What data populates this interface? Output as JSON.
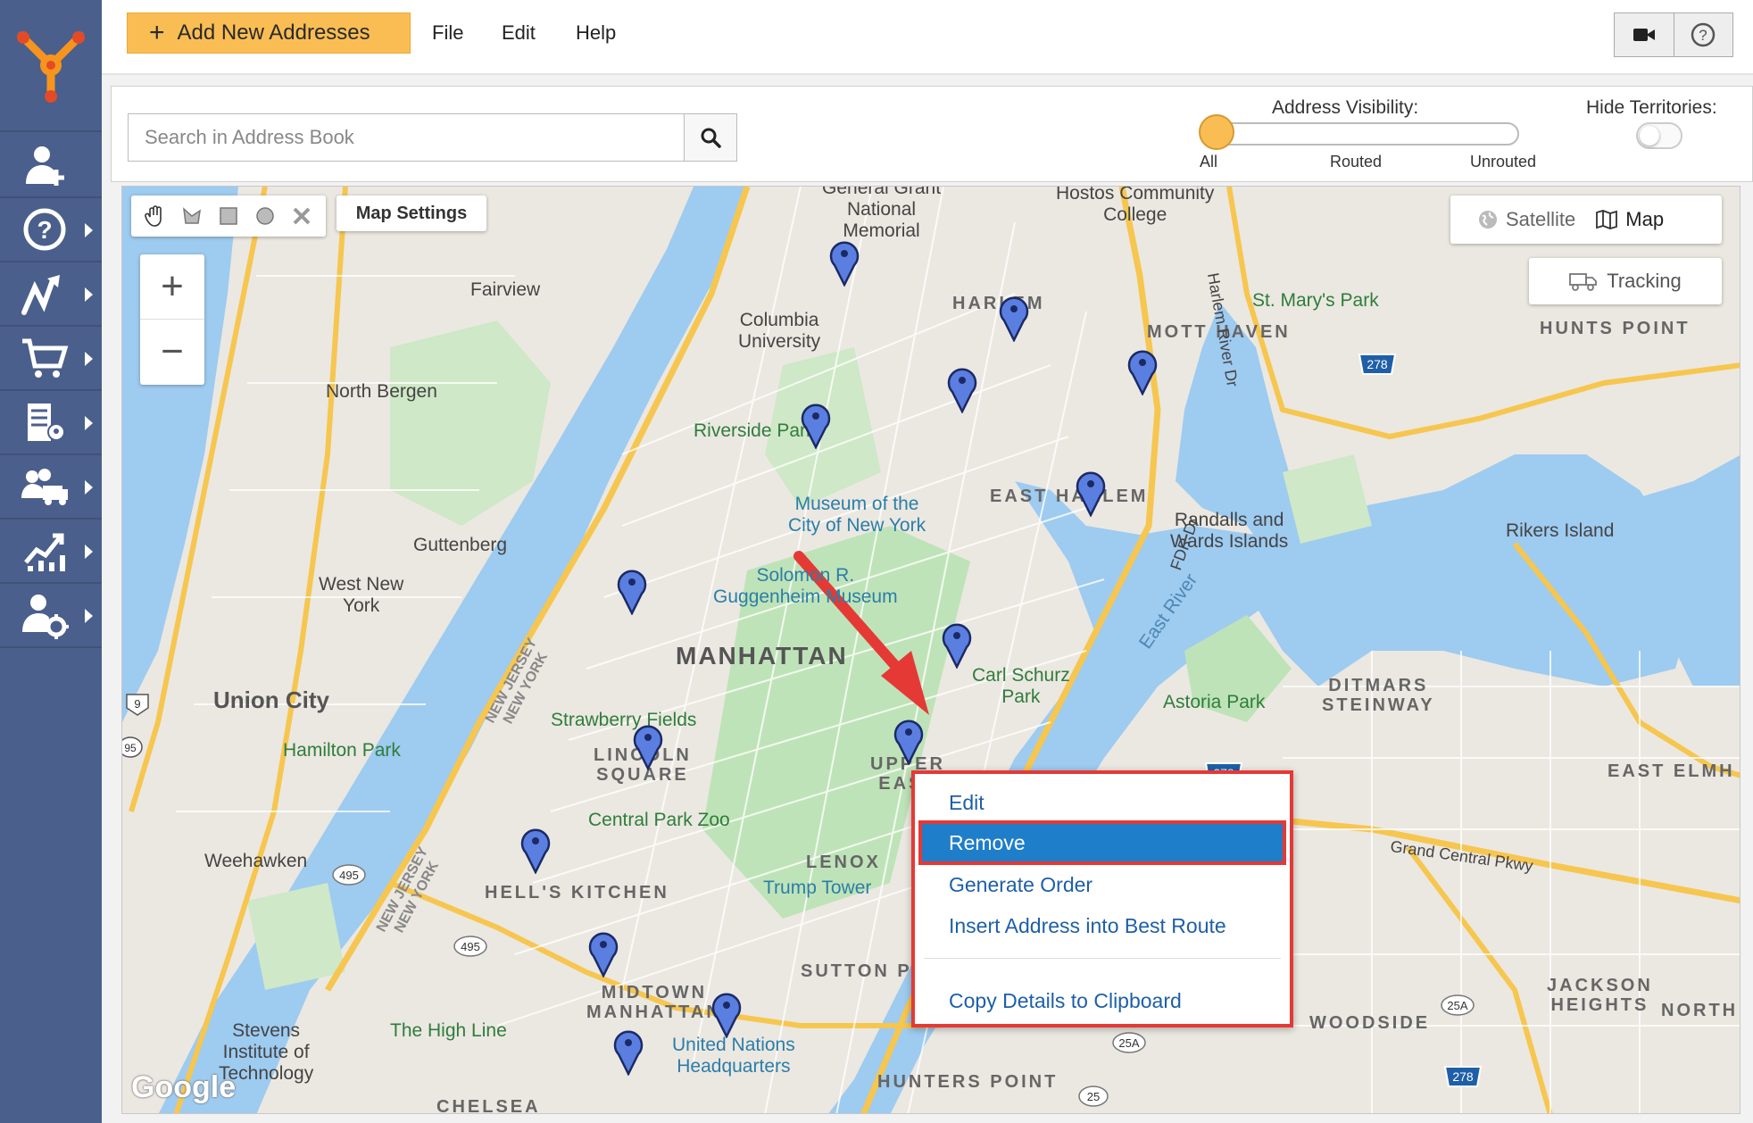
{
  "toolbar": {
    "add_label": "Add New Addresses",
    "menu": [
      "File",
      "Edit",
      "Help"
    ]
  },
  "search": {
    "placeholder": "Search in Address Book"
  },
  "visibility": {
    "title": "Address Visibility:",
    "options": [
      "All",
      "Routed",
      "Unrouted"
    ],
    "selected": "All"
  },
  "territories": {
    "title": "Hide Territories:",
    "on": false
  },
  "map": {
    "settings_label": "Map Settings",
    "type_options": [
      "Satellite",
      "Map"
    ],
    "type_selected": "Map",
    "tracking_label": "Tracking",
    "labels": {
      "manhattan": "MANHATTAN",
      "harlem": "HARLEM",
      "east_harlem": "EAST HARLEM",
      "mott_haven": "MOTT HAVEN",
      "hunts_point": "HUNTS POINT",
      "union_city": "Union City",
      "fairview": "Fairview",
      "north_bergen": "North Bergen",
      "guttenberg": "Guttenberg",
      "west_new_york": "West New\nYork",
      "weehawken": "Weehawken",
      "hamilton_park": "Hamilton Park",
      "hells_kitchen": "HELL'S KITCHEN",
      "midtown": "MIDTOWN\nMANHATTAN",
      "lincoln_square": "LINCOLN\nSQUARE",
      "upper_east": "UPPER\nEAST",
      "lenox": "LENOX",
      "sutton_place": "SUTTON PLA",
      "hunters_point": "HUNTERS POINT",
      "woodside": "WOODSIDE",
      "ditmars": "DITMARS\nSTEINWAY",
      "east_elmhurst": "EAST ELMH",
      "jackson_heights": "JACKSON\nHEIGHTS",
      "north": "NORTH",
      "chelsea": "CHELSEA",
      "columbia": "Columbia\nUniversity",
      "grant": "General Grant\nNational\nMemorial",
      "hostos": "Hostos Community\nCollege",
      "st_marys": "St. Mary's Park",
      "riverside": "Riverside Park",
      "museum_nyc": "Museum of the\nCity of New York",
      "guggenheim": "Solomon R.\nGuggenheim Museum",
      "carl_schurz": "Carl Schurz\nPark",
      "randalls": "Randalls and\nWards Islands",
      "rikers": "Rikers Island",
      "astoria_park": "Astoria Park",
      "strawberry": "Strawberry Fields",
      "central_park_zoo": "Central Park Zoo",
      "trump_tower": "Trump Tower",
      "high_line": "The High Line",
      "un": "United Nations\nHeadquarters",
      "stevens": "Stevens\nInstitute of\nTechnology",
      "east_river": "East River",
      "grand_central": "Grand Central Pkwy",
      "nj_ny_1": "NEW JERSEY\nNEW YORK",
      "nj_ny_2": "NEW JERSEY\nNEW YORK",
      "harlem_river": "Harlem River Dr",
      "fdr": "FDR Dr",
      "google": "Google"
    },
    "shields": [
      "278",
      "278",
      "278",
      "495",
      "495",
      "25A",
      "25A",
      "25",
      "9",
      "95"
    ]
  },
  "context_menu": {
    "items": [
      "Edit",
      "Remove",
      "Generate Order",
      "Insert Address into Best Route",
      "Copy Details to Clipboard"
    ],
    "selected": "Remove"
  },
  "colors": {
    "sidebar": "#4a5f8b",
    "accent": "#f9bd54",
    "pin": "#5b7fe0",
    "highlight": "#e53935",
    "selected_item": "#1f7ec9"
  }
}
